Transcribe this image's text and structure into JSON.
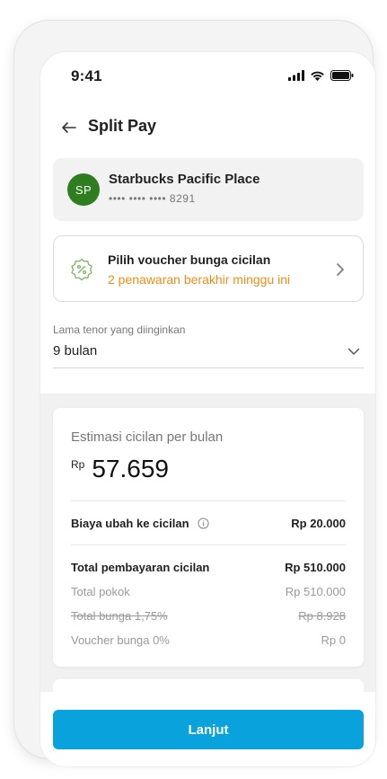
{
  "status": {
    "time": "9:41"
  },
  "header": {
    "title": "Split Pay"
  },
  "merchant": {
    "initials": "SP",
    "name": "Starbucks Pacific Place",
    "card": "•••• •••• •••• 8291",
    "avatar_color": "#2e7d1f"
  },
  "voucher": {
    "title": "Pilih voucher bunga cicilan",
    "subtitle": "2 penawaran berakhir minggu ini",
    "accent": "#f28c17"
  },
  "tenor": {
    "label": "Lama tenor yang diinginkan",
    "value": "9 bulan"
  },
  "estimate": {
    "label": "Estimasi cicilan per bulan",
    "currency": "Rp",
    "amount": "57.659",
    "fee": {
      "label": "Biaya ubah ke cicilan",
      "value": "Rp 20.000"
    },
    "total": {
      "label": "Total pembayaran cicilan",
      "value": "Rp 510.000"
    },
    "principal": {
      "label": "Total pokok",
      "value": "Rp 510.000"
    },
    "interest": {
      "label": "Total bunga 1,75%",
      "value": "Rp 8.928"
    },
    "voucher": {
      "label": "Voucher bunga 0%",
      "value": "Rp 0"
    }
  },
  "footer": {
    "cta": "Lanjut",
    "cta_color": "#0aa2dd"
  }
}
